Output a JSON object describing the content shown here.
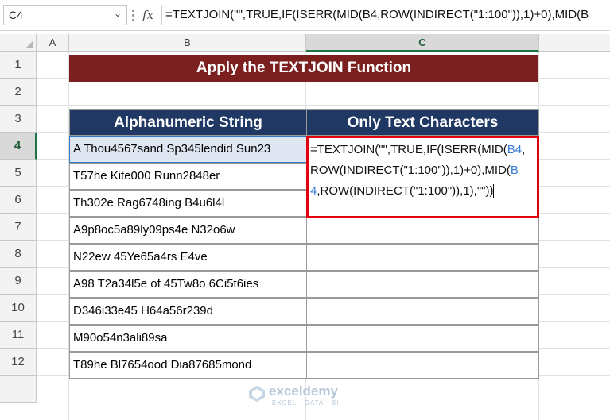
{
  "formula_bar": {
    "name_box": "C4",
    "fx_label": "fx",
    "formula": "=TEXTJOIN(\"\",TRUE,IF(ISERR(MID(B4,ROW(INDIRECT(\"1:100\")),1)+0),MID(B"
  },
  "columns": [
    "A",
    "B",
    "C"
  ],
  "rows": [
    "1",
    "2",
    "3",
    "4",
    "5",
    "6",
    "7",
    "8",
    "9",
    "10",
    "11",
    "12"
  ],
  "selected_cell": "C4",
  "title": "Apply the TEXTJOIN Function",
  "table": {
    "headers": [
      "Alphanumeric String",
      "Only Text Characters"
    ],
    "strings": [
      "A Thou4567sand Sp345lendid Sun23",
      "T57he Kite000 Runn2848er",
      "Th302e Rag6748ing B4u6l4l",
      "A9p8oc5a89ly09ps4e N32o6w",
      "N22ew 45Ye65a4rs E4ve",
      "A98 T2a34l5e of 45Tw8o 6Ci5t6ies",
      "D346i33e45 H64a56r239d",
      "M90o54n3ali89sa",
      "T89he Bl7654ood Dia87685mond"
    ]
  },
  "editing": {
    "line1_a": "=TEXTJOIN(\"\",TRUE,IF(ISERR(MID(",
    "line1_ref": "B4",
    "line1_b": ",",
    "line2_a": "ROW(INDIRECT(\"1:100\")),1)+0),MID(",
    "line2_ref": "B",
    "line3_ref": "4",
    "line3_b": ",ROW(INDIRECT(\"1:100\")),1),\"\"))"
  },
  "watermark": {
    "name": "exceldemy",
    "tagline": "EXCEL · DATA · BI"
  },
  "colors": {
    "title_bg": "#7b1f1f",
    "header_bg": "#1f3864",
    "edit_border": "#e3000f",
    "ref_blue": "#3a7bd5",
    "excel_green": "#217346"
  }
}
